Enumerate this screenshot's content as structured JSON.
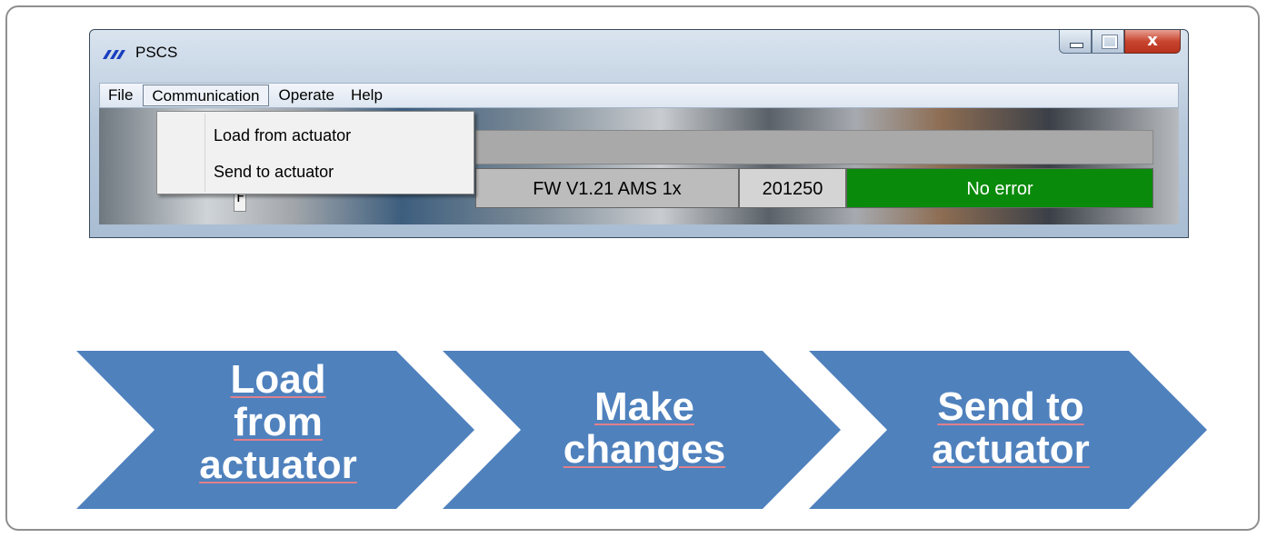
{
  "window": {
    "title": "PSCS",
    "logo_icon": "pscs-logo-icon",
    "controls": {
      "minimize": "minimize-icon",
      "maximize": "maximize-icon",
      "close": "x"
    }
  },
  "menubar": {
    "items": [
      "File",
      "Communication",
      "Operate",
      "Help"
    ],
    "active": "Communication"
  },
  "dropdown": {
    "items": [
      "Load from actuator",
      "Send to actuator"
    ]
  },
  "statusbar": {
    "firmware": "FW  V1.21 AMS 1x",
    "serial": "201250",
    "error": "No error",
    "error_color": "#0a8a0a"
  },
  "partial_button_label": "F",
  "process_steps": [
    {
      "lines": [
        "Load",
        "from",
        "actuator"
      ]
    },
    {
      "lines": [
        "Make",
        "changes"
      ]
    },
    {
      "lines": [
        "Send to",
        "actuator"
      ]
    }
  ],
  "colors": {
    "chevron": "#4f81bd",
    "chevron_text": "#ffffff"
  }
}
